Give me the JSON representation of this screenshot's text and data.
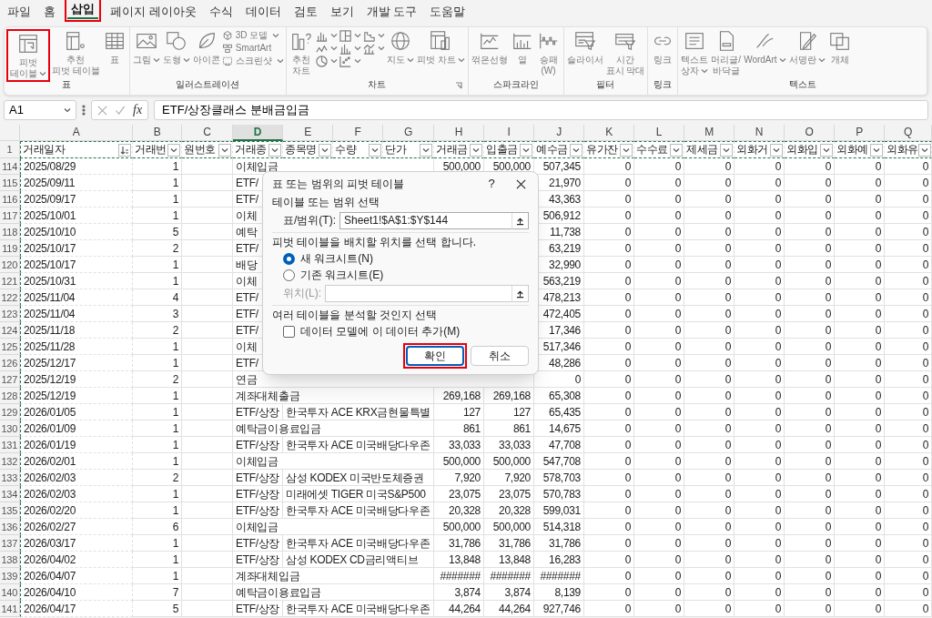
{
  "tabs": [
    {
      "label": "파일",
      "selected": false,
      "highlighted": false
    },
    {
      "label": "홈",
      "selected": false,
      "highlighted": false
    },
    {
      "label": "삽입",
      "selected": true,
      "highlighted": true
    },
    {
      "label": "페이지 레이아웃",
      "selected": false,
      "highlighted": false
    },
    {
      "label": "수식",
      "selected": false,
      "highlighted": false
    },
    {
      "label": "데이터",
      "selected": false,
      "highlighted": false
    },
    {
      "label": "검토",
      "selected": false,
      "highlighted": false
    },
    {
      "label": "보기",
      "selected": false,
      "highlighted": false
    },
    {
      "label": "개발 도구",
      "selected": false,
      "highlighted": false
    },
    {
      "label": "도움말",
      "selected": false,
      "highlighted": false
    }
  ],
  "ribbon": {
    "disabled": true,
    "groups": [
      {
        "label": "표",
        "items": [
          {
            "kind": "large",
            "lines": [
              "피벗",
              "테이블"
            ],
            "caret": true,
            "highlighted": true
          },
          {
            "kind": "large",
            "lines": [
              "추천",
              "피벗 테이블"
            ],
            "caret": false,
            "highlighted": false
          },
          {
            "kind": "large",
            "lines": [
              "표"
            ],
            "caret": false,
            "highlighted": false
          }
        ]
      },
      {
        "label": "일러스트레이션",
        "items": [
          {
            "kind": "large",
            "lines": [
              "그림"
            ],
            "caret": true,
            "highlighted": false
          },
          {
            "kind": "large",
            "lines": [
              "도형"
            ],
            "caret": true,
            "highlighted": false
          },
          {
            "kind": "large",
            "lines": [
              "아이콘"
            ],
            "caret": false,
            "highlighted": false
          },
          {
            "kind": "small",
            "lines": [
              "3D 모델"
            ],
            "caret": true,
            "highlighted": false
          },
          {
            "kind": "small",
            "lines": [
              "SmartArt"
            ],
            "caret": false,
            "highlighted": false
          },
          {
            "kind": "small",
            "lines": [
              "스크린샷"
            ],
            "caret": true,
            "highlighted": false
          }
        ]
      },
      {
        "label": "차트",
        "items": [
          {
            "kind": "large",
            "lines": [
              "추천",
              "차트"
            ],
            "caret": false,
            "highlighted": false
          },
          {
            "kind": "icon",
            "caret": true,
            "highlighted": false
          },
          {
            "kind": "icon",
            "caret": true,
            "highlighted": false
          },
          {
            "kind": "icon",
            "caret": true,
            "highlighted": false
          },
          {
            "kind": "icon",
            "caret": true,
            "highlighted": false
          },
          {
            "kind": "icon",
            "caret": true,
            "highlighted": false
          },
          {
            "kind": "icon",
            "caret": true,
            "highlighted": false
          },
          {
            "kind": "icon",
            "caret": true,
            "highlighted": false
          },
          {
            "kind": "icon",
            "caret": true,
            "highlighted": false
          },
          {
            "kind": "large",
            "lines": [
              "지도"
            ],
            "caret": true,
            "highlighted": false
          },
          {
            "kind": "large",
            "lines": [
              "피벗 차트"
            ],
            "caret": true,
            "highlighted": false
          }
        ]
      },
      {
        "label": "스파크라인",
        "items": [
          {
            "kind": "large",
            "lines": [
              "꺾은선형"
            ],
            "caret": false,
            "highlighted": false
          },
          {
            "kind": "large",
            "lines": [
              "열"
            ],
            "caret": false,
            "highlighted": false
          },
          {
            "kind": "large",
            "lines": [
              "승패",
              "(W)"
            ],
            "caret": false,
            "highlighted": false
          }
        ]
      },
      {
        "label": "필터",
        "items": [
          {
            "kind": "large",
            "lines": [
              "슬라이서"
            ],
            "caret": false,
            "highlighted": false
          },
          {
            "kind": "large",
            "lines": [
              "시간",
              "표시 막대"
            ],
            "caret": false,
            "highlighted": false
          }
        ]
      },
      {
        "label": "링크",
        "items": [
          {
            "kind": "large",
            "lines": [
              "링크"
            ],
            "caret": false,
            "highlighted": false
          }
        ]
      },
      {
        "label": "텍스트",
        "items": [
          {
            "kind": "large",
            "lines": [
              "텍스트",
              "상자"
            ],
            "caret": true,
            "highlighted": false
          },
          {
            "kind": "large",
            "lines": [
              "머리글/",
              "바닥글"
            ],
            "caret": false,
            "highlighted": false
          },
          {
            "kind": "large",
            "lines": [
              "WordArt"
            ],
            "caret": true,
            "highlighted": false
          },
          {
            "kind": "large",
            "lines": [
              "서명란"
            ],
            "caret": true,
            "highlighted": false
          },
          {
            "kind": "large",
            "lines": [
              "개체"
            ],
            "caret": false,
            "highlighted": false
          }
        ]
      }
    ]
  },
  "formula_bar": {
    "name_box": "A1",
    "fx": "fx",
    "formula": "ETF/상장클래스 분배금입금"
  },
  "header_row": "1",
  "columns": [
    {
      "letter": "A",
      "header": "거래일자",
      "kind": "text",
      "selected": false,
      "sorted": true
    },
    {
      "letter": "B",
      "header": "거래번",
      "kind": "number",
      "selected": false,
      "sorted": false
    },
    {
      "letter": "C",
      "header": "원번호",
      "kind": "text",
      "selected": false,
      "sorted": false
    },
    {
      "letter": "D",
      "header": "거래종",
      "kind": "text",
      "selected": true,
      "sorted": false
    },
    {
      "letter": "E",
      "header": "종목명",
      "kind": "text",
      "selected": false,
      "sorted": false
    },
    {
      "letter": "F",
      "header": "수량",
      "selected": false,
      "sorted": false
    },
    {
      "letter": "G",
      "header": "단가",
      "selected": false,
      "sorted": false
    },
    {
      "letter": "H",
      "header": "거래금",
      "kind": "number",
      "selected": false,
      "sorted": false
    },
    {
      "letter": "I",
      "header": "입출금",
      "kind": "number",
      "selected": false,
      "sorted": false
    },
    {
      "letter": "J",
      "header": "예수금",
      "kind": "number",
      "selected": false,
      "sorted": false
    },
    {
      "letter": "K",
      "header": "유가잔",
      "kind": "number",
      "selected": false,
      "sorted": false
    },
    {
      "letter": "L",
      "header": "수수료",
      "kind": "number",
      "selected": false,
      "sorted": false
    },
    {
      "letter": "M",
      "header": "제세금",
      "kind": "number",
      "selected": false,
      "sorted": false
    },
    {
      "letter": "N",
      "header": "외화거",
      "kind": "number",
      "selected": false,
      "sorted": false
    },
    {
      "letter": "O",
      "header": "외화입",
      "kind": "number",
      "selected": false,
      "sorted": false
    },
    {
      "letter": "P",
      "header": "외화예",
      "kind": "number",
      "selected": false,
      "sorted": false
    },
    {
      "letter": "Q",
      "header": "외화유",
      "kind": "number",
      "selected": false,
      "sorted": false
    }
  ],
  "rows": [
    {
      "num": "114",
      "cells": [
        "2025/08/29",
        "1",
        null,
        "이체입금",
        null,
        null,
        null,
        "500,000",
        "500,000",
        "507,345",
        "0",
        "0",
        "0",
        "0",
        "0",
        "0",
        "0"
      ]
    },
    {
      "num": "115",
      "cells": [
        "2025/09/11",
        "1",
        null,
        "ETF/",
        null,
        null,
        null,
        null,
        null,
        "21,970",
        "0",
        "0",
        "0",
        "0",
        "0",
        "0",
        "0"
      ]
    },
    {
      "num": "116",
      "cells": [
        "2025/09/17",
        "1",
        null,
        "ETF/",
        null,
        null,
        null,
        null,
        null,
        "43,363",
        "0",
        "0",
        "0",
        "0",
        "0",
        "0",
        "0"
      ]
    },
    {
      "num": "117",
      "cells": [
        "2025/10/01",
        "1",
        null,
        "이체",
        null,
        null,
        null,
        null,
        null,
        "506,912",
        "0",
        "0",
        "0",
        "0",
        "0",
        "0",
        "0"
      ]
    },
    {
      "num": "118",
      "cells": [
        "2025/10/10",
        "5",
        null,
        "예탁",
        null,
        null,
        null,
        null,
        null,
        "11,738",
        "0",
        "0",
        "0",
        "0",
        "0",
        "0",
        "0"
      ]
    },
    {
      "num": "119",
      "cells": [
        "2025/10/17",
        "2",
        null,
        "ETF/",
        null,
        null,
        null,
        null,
        null,
        "63,219",
        "0",
        "0",
        "0",
        "0",
        "0",
        "0",
        "0"
      ]
    },
    {
      "num": "120",
      "cells": [
        "2025/10/17",
        "1",
        null,
        "배당",
        null,
        null,
        null,
        null,
        null,
        "32,990",
        "0",
        "0",
        "0",
        "0",
        "0",
        "0",
        "0"
      ]
    },
    {
      "num": "121",
      "cells": [
        "2025/10/31",
        "1",
        null,
        "이체",
        null,
        null,
        null,
        null,
        null,
        "563,219",
        "0",
        "0",
        "0",
        "0",
        "0",
        "0",
        "0"
      ]
    },
    {
      "num": "122",
      "cells": [
        "2025/11/04",
        "4",
        null,
        "ETF/",
        null,
        null,
        null,
        null,
        null,
        "478,213",
        "0",
        "0",
        "0",
        "0",
        "0",
        "0",
        "0"
      ]
    },
    {
      "num": "123",
      "cells": [
        "2025/11/04",
        "3",
        null,
        "ETF/",
        null,
        null,
        null,
        null,
        null,
        "472,405",
        "0",
        "0",
        "0",
        "0",
        "0",
        "0",
        "0"
      ]
    },
    {
      "num": "124",
      "cells": [
        "2025/11/18",
        "2",
        null,
        "ETF/",
        null,
        null,
        null,
        null,
        null,
        "17,346",
        "0",
        "0",
        "0",
        "0",
        "0",
        "0",
        "0"
      ]
    },
    {
      "num": "125",
      "cells": [
        "2025/11/28",
        "1",
        null,
        "이체",
        null,
        null,
        null,
        null,
        null,
        "517,346",
        "0",
        "0",
        "0",
        "0",
        "0",
        "0",
        "0"
      ]
    },
    {
      "num": "126",
      "cells": [
        "2025/12/17",
        "1",
        null,
        "ETF/",
        null,
        null,
        null,
        null,
        null,
        "48,286",
        "0",
        "0",
        "0",
        "0",
        "0",
        "0",
        "0"
      ]
    },
    {
      "num": "127",
      "cells": [
        "2025/12/19",
        "2",
        null,
        "연금",
        null,
        null,
        null,
        null,
        null,
        "0",
        "0",
        "0",
        "0",
        "0",
        "0",
        "0",
        "0"
      ]
    },
    {
      "num": "128",
      "cells": [
        "2025/12/19",
        "1",
        null,
        "계좌대체출금",
        null,
        null,
        null,
        "269,168",
        "269,168",
        "65,308",
        "0",
        "0",
        "0",
        "0",
        "0",
        "0",
        "0"
      ]
    },
    {
      "num": "129",
      "cells": [
        "2026/01/05",
        "1",
        null,
        "ETF/상장",
        "한국투자 ACE KRX금현물특별",
        null,
        null,
        "127",
        "127",
        "65,435",
        "0",
        "0",
        "0",
        "0",
        "0",
        "0",
        "0"
      ]
    },
    {
      "num": "130",
      "cells": [
        "2026/01/09",
        "1",
        null,
        "예탁금이용료입금",
        null,
        null,
        null,
        "861",
        "861",
        "14,675",
        "0",
        "0",
        "0",
        "0",
        "0",
        "0",
        "0"
      ]
    },
    {
      "num": "131",
      "cells": [
        "2026/01/19",
        "1",
        null,
        "ETF/상장",
        "한국투자 ACE 미국배당다우존",
        null,
        null,
        "33,033",
        "33,033",
        "47,708",
        "0",
        "0",
        "0",
        "0",
        "0",
        "0",
        "0"
      ]
    },
    {
      "num": "132",
      "cells": [
        "2026/02/01",
        "1",
        null,
        "이체입금",
        null,
        null,
        null,
        "500,000",
        "500,000",
        "547,708",
        "0",
        "0",
        "0",
        "0",
        "0",
        "0",
        "0"
      ]
    },
    {
      "num": "133",
      "cells": [
        "2026/02/03",
        "2",
        null,
        "ETF/상장",
        "삼성 KODEX 미국반도체증권",
        null,
        null,
        "7,920",
        "7,920",
        "578,703",
        "0",
        "0",
        "0",
        "0",
        "0",
        "0",
        "0"
      ]
    },
    {
      "num": "134",
      "cells": [
        "2026/02/03",
        "1",
        null,
        "ETF/상장",
        "미래에셋 TIGER 미국S&P500",
        null,
        null,
        "23,075",
        "23,075",
        "570,783",
        "0",
        "0",
        "0",
        "0",
        "0",
        "0",
        "0"
      ]
    },
    {
      "num": "135",
      "cells": [
        "2026/02/20",
        "1",
        null,
        "ETF/상장",
        "한국투자 ACE 미국배당다우존",
        null,
        null,
        "20,328",
        "20,328",
        "599,031",
        "0",
        "0",
        "0",
        "0",
        "0",
        "0",
        "0"
      ]
    },
    {
      "num": "136",
      "cells": [
        "2026/02/27",
        "6",
        null,
        "이체입금",
        null,
        null,
        null,
        "500,000",
        "500,000",
        "514,318",
        "0",
        "0",
        "0",
        "0",
        "0",
        "0",
        "0"
      ]
    },
    {
      "num": "137",
      "cells": [
        "2026/03/17",
        "1",
        null,
        "ETF/상장",
        "한국투자 ACE 미국배당다우존",
        null,
        null,
        "31,786",
        "31,786",
        "31,786",
        "0",
        "0",
        "0",
        "0",
        "0",
        "0",
        "0"
      ]
    },
    {
      "num": "138",
      "cells": [
        "2026/04/02",
        "1",
        null,
        "ETF/상장",
        "삼성 KODEX CD금리액티브",
        null,
        null,
        "13,848",
        "13,848",
        "16,283",
        "0",
        "0",
        "0",
        "0",
        "0",
        "0",
        "0"
      ]
    },
    {
      "num": "139",
      "cells": [
        "2026/04/07",
        "1",
        null,
        "계좌대체입금",
        null,
        null,
        null,
        "#######",
        "#######",
        "#######",
        "0",
        "0",
        "0",
        "0",
        "0",
        "0",
        "0"
      ]
    },
    {
      "num": "140",
      "cells": [
        "2026/04/10",
        "7",
        null,
        "예탁금이용료입금",
        null,
        null,
        null,
        "3,874",
        "3,874",
        "8,139",
        "0",
        "0",
        "0",
        "0",
        "0",
        "0",
        "0"
      ]
    },
    {
      "num": "141",
      "cells": [
        "2026/04/17",
        "5",
        null,
        "ETF/상장",
        "한국투자 ACE 미국배당다우존",
        null,
        null,
        "44,264",
        "44,264",
        "927,746",
        "0",
        "0",
        "0",
        "0",
        "0",
        "0",
        "0"
      ]
    }
  ],
  "dialog": {
    "title": "표 또는 범위의 피벗 테이블",
    "help": "?",
    "section_source": "테이블 또는 범위 선택",
    "range_label": "표/범위(T):",
    "range_value": "Sheet1!$A$1:$Y$144",
    "section_location": "피벗 테이블을 배치할 위치를 선택 합니다.",
    "options": [
      {
        "label": "새 워크시트(N)",
        "selected": true
      },
      {
        "label": "기존 워크시트(E)",
        "selected": false
      }
    ],
    "location_label": "위치(L):",
    "location_disabled": true,
    "section_model": "여러 테이블을 분석할 것인지 선택",
    "model_checkbox": {
      "label": "데이터 모델에 이 데이터 추가(M)",
      "checked": false
    },
    "buttons": [
      {
        "label": "확인",
        "highlighted": true,
        "default": true
      },
      {
        "label": "취소",
        "highlighted": false,
        "default": false
      }
    ]
  }
}
